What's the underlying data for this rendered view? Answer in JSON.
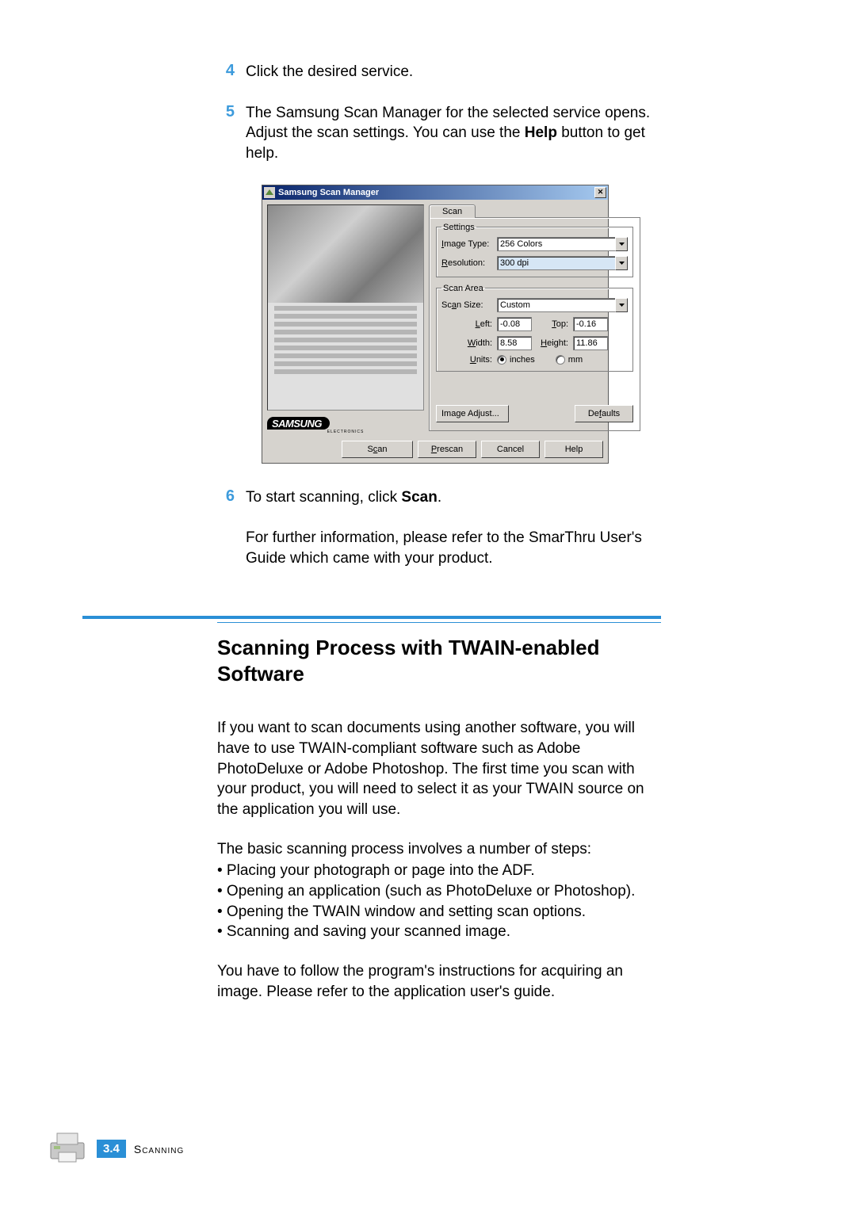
{
  "steps": {
    "s4": {
      "num": "4",
      "text": "Click the desired service."
    },
    "s5": {
      "num": "5",
      "pre": "The Samsung Scan Manager for the selected service opens. Adjust the scan settings. You can use the ",
      "bold": "Help",
      "post": " button to get help."
    },
    "s6": {
      "num": "6",
      "pre": "To start scanning, click ",
      "bold": "Scan",
      "post": "."
    },
    "s6_sub": "For further information, please refer to the SmarThru User's Guide which came with your product."
  },
  "dialog": {
    "title": "Samsung Scan Manager",
    "logo": "SAMSUNG",
    "logo_sub": "ELECTRONICS",
    "tab_scan": "Scan",
    "grp_settings": "Settings",
    "grp_scanarea": "Scan Area",
    "lbl_image_type": "Image Type:",
    "lbl_resolution": "Resolution:",
    "lbl_scan_size": "Scan Size:",
    "lbl_left": "Left:",
    "lbl_top": "Top:",
    "lbl_width": "Width:",
    "lbl_height": "Height:",
    "lbl_units": "Units:",
    "val_image_type": "256 Colors",
    "val_resolution": "300 dpi",
    "val_scan_size": "Custom",
    "val_left": "-0.08",
    "val_top": "-0.16",
    "val_width": "8.58",
    "val_height": "11.86",
    "radio_inches": "inches",
    "radio_mm": "mm",
    "btn_image_adjust": "Image Adjust...",
    "btn_defaults": "Defaults",
    "btn_scan": "Scan",
    "btn_prescan": "Prescan",
    "btn_cancel": "Cancel",
    "btn_help": "Help"
  },
  "section": {
    "heading": "Scanning Process with TWAIN-enabled Software",
    "p1": "If you want to scan documents using another software, you will have to use TWAIN-compliant software such as Adobe PhotoDeluxe or Adobe Photoshop. The first time you scan with your product, you will need to select it as your TWAIN source on the application you will use.",
    "p2": "The basic scanning process involves a number of steps:",
    "b1": "• Placing your photograph or page into the ADF.",
    "b2": "• Opening an application (such as PhotoDeluxe or Photoshop).",
    "b3": "• Opening the TWAIN window and setting scan options.",
    "b4": "• Scanning and saving your scanned image.",
    "p3": "You have to follow the program's instructions for acquiring an image. Please refer to the application user's guide."
  },
  "footer": {
    "page": "3.4",
    "chapter": "Scanning"
  }
}
